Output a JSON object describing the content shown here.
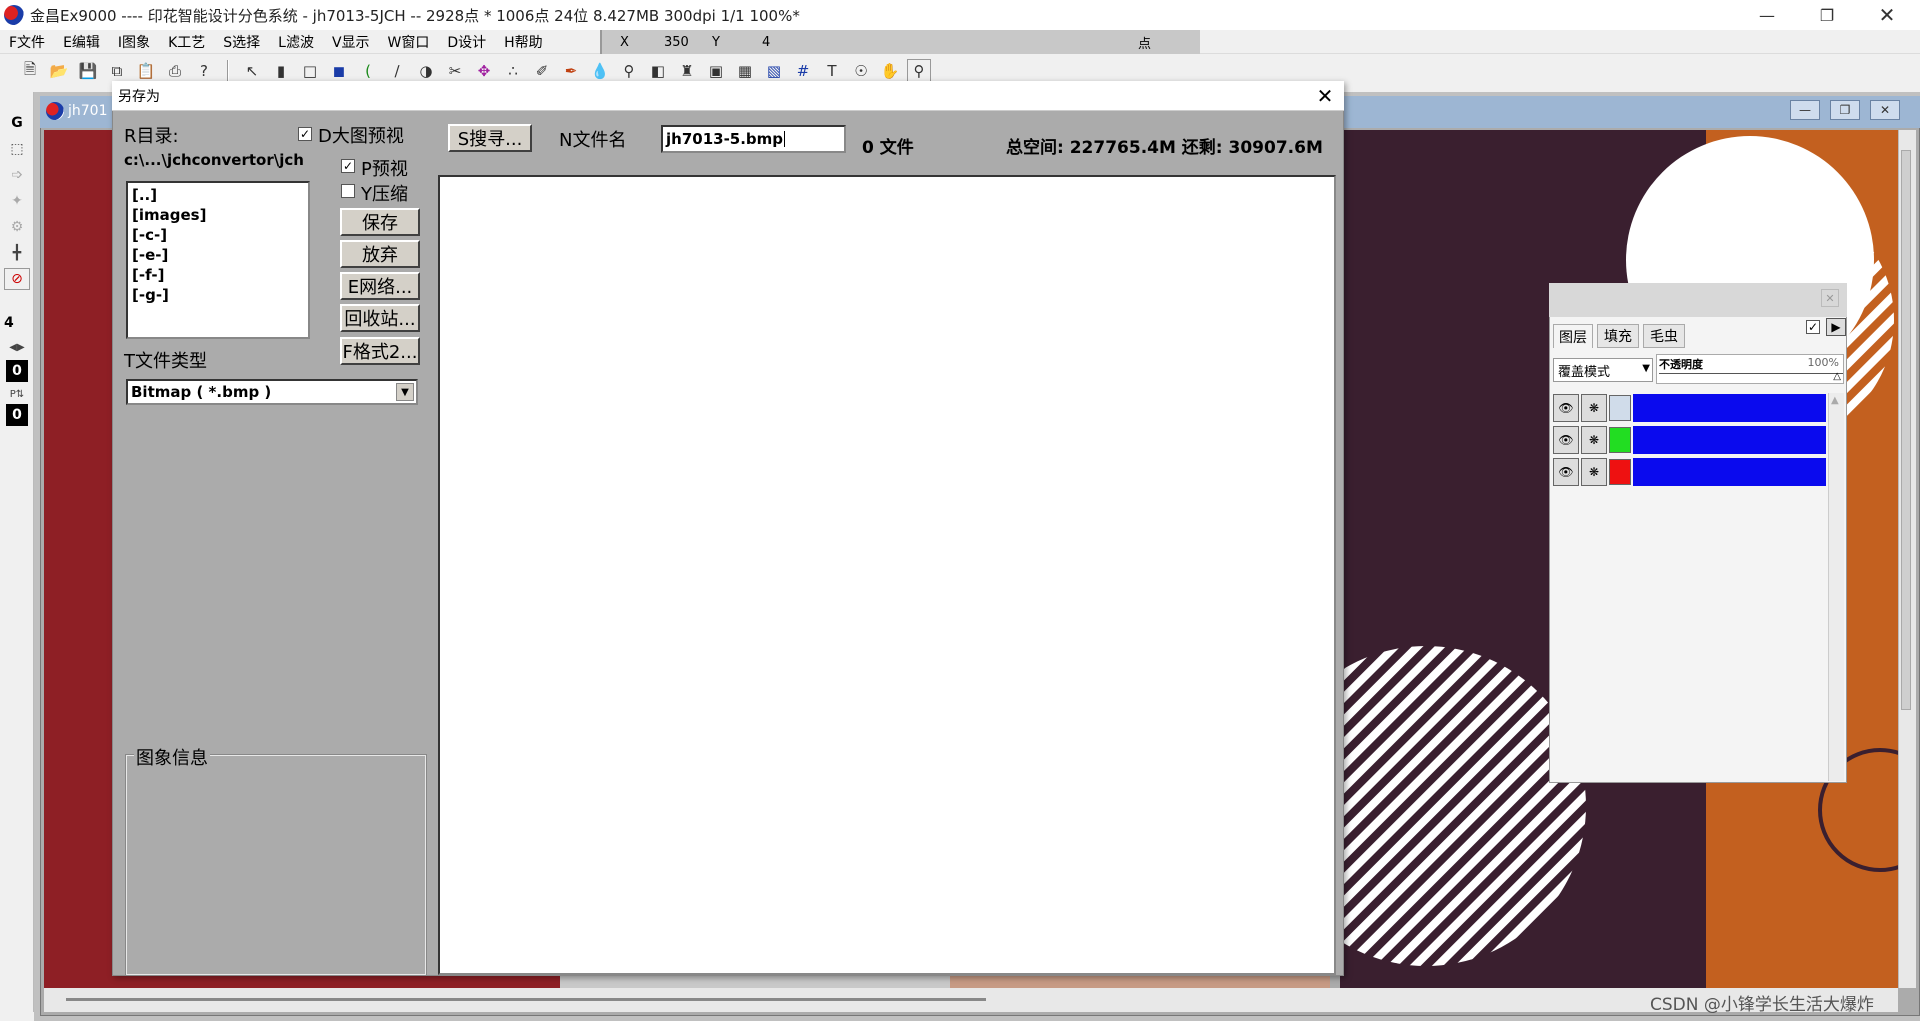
{
  "app": {
    "title": "金昌Ex9000 ---- 印花智能设计分色系统 - jh7013-5JCH -- 2928点 * 1006点 24位   8.427MB 300dpi 1/1    100%*",
    "child_title": "jh701"
  },
  "menu": [
    "F文件",
    "E编辑",
    "I图象",
    "K工艺",
    "S选择",
    "L滤波",
    "V显示",
    "W窗口",
    "D设计",
    "H帮助"
  ],
  "coords": {
    "x_label": "X",
    "x_value": "350",
    "y_label": "Y",
    "y_value": "4",
    "unit": "点"
  },
  "left_tools": {
    "g_label": "G",
    "size_value": "4",
    "num_top": "0",
    "num_bottom": "0"
  },
  "dialog": {
    "title": "另存为",
    "dir_label": "R目录:",
    "dir_path": "c:\\...\\jchconvertor\\jch",
    "dir_items": [
      "[..]",
      "[images]",
      "[-c-]",
      "[-e-]",
      "[-f-]",
      "[-g-]"
    ],
    "large_preview_label": "D大图预视",
    "large_preview_checked": true,
    "preview_label": "P预视",
    "preview_checked": true,
    "compress_label": "Y压缩",
    "compress_checked": false,
    "buttons": {
      "save": "保存",
      "cancel": "放弃",
      "network": "E网络...",
      "recycle": "回收站...",
      "format2": "F格式2...",
      "search": "S搜寻..."
    },
    "filename_label": "N文件名",
    "filename_value": "jh7013-5.bmp",
    "file_count": "0 文件",
    "space_info": "总空间: 227765.4M  还剩: 30907.6M",
    "file_type_label": "T文件类型",
    "file_type_value": "Bitmap ( *.bmp )",
    "image_info_label": "图象信息"
  },
  "layers_panel": {
    "tabs": [
      "图层",
      "填充",
      "毛虫"
    ],
    "blend_mode": "覆盖模式",
    "opacity_label": "不透明度",
    "opacity_value": "100%",
    "layers": [
      {
        "swatch": "#d0dcea"
      },
      {
        "swatch": "#22dd22"
      },
      {
        "swatch": "#ee1111"
      }
    ]
  },
  "watermark": "CSDN @小锋学长生活大爆炸",
  "colors": {
    "layer_bar": "#0a0aee",
    "canvas_red": "#8e1f25",
    "canvas_dark": "#3a1f2f",
    "canvas_orange": "#c3601f"
  }
}
